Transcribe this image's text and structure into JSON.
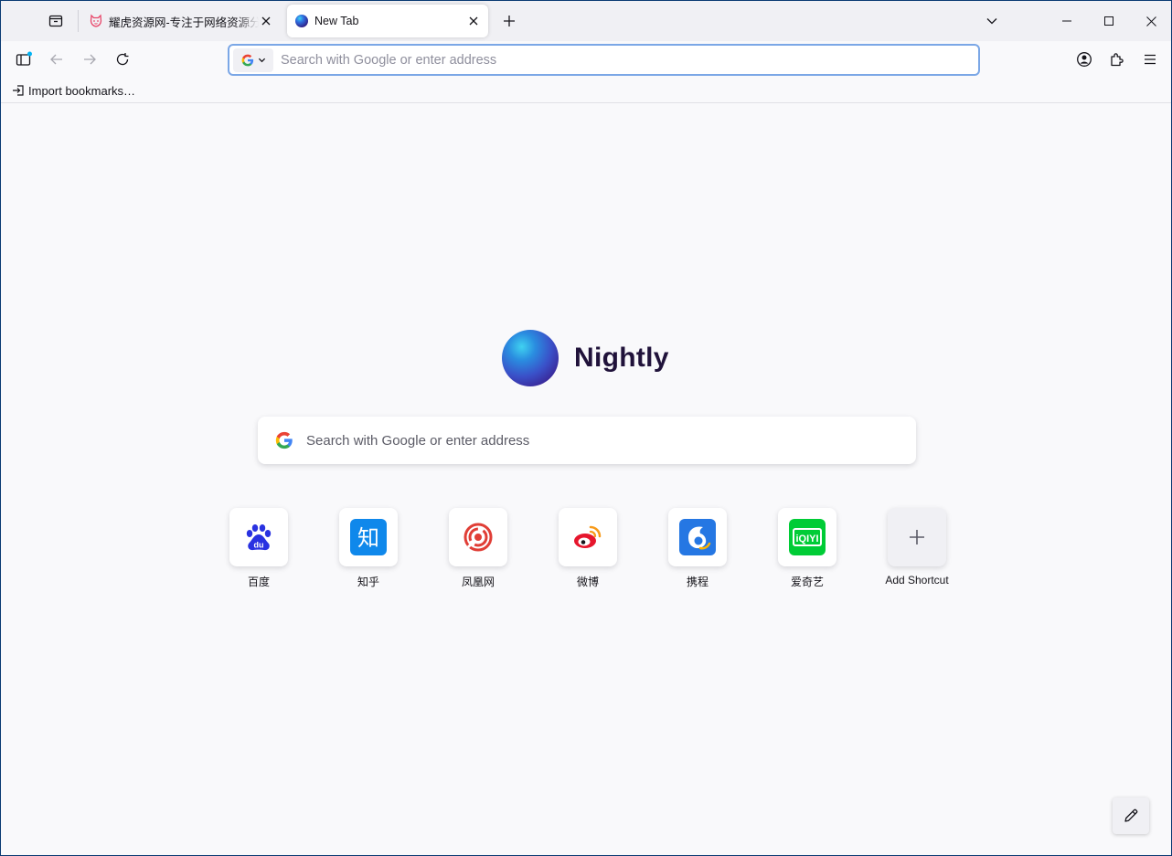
{
  "colors": {
    "accent": "#0061e0",
    "urlbar_focus": "#7ba7e6",
    "window_border": "#0a3a73",
    "tabstrip_bg": "#f0f0f4",
    "content_bg": "#f9f9fb"
  },
  "tabs": [
    {
      "title": "耀虎资源网-专注于网络资源分享",
      "favicon": "tiger-icon",
      "active": false
    },
    {
      "title": "New Tab",
      "favicon": "nightly-icon",
      "active": true
    }
  ],
  "urlbar": {
    "placeholder": "Search with Google or enter address",
    "value": "",
    "engine": "google-icon"
  },
  "bookmarks_toolbar": {
    "import_label": "Import bookmarks…"
  },
  "newtab": {
    "logo_text": "Nightly",
    "search_placeholder": "Search with Google or enter address",
    "shortcuts": [
      {
        "label": "百度",
        "icon": "baidu-icon",
        "color": "#2932e1"
      },
      {
        "label": "知乎",
        "icon": "zhihu-icon",
        "color": "#0f88eb"
      },
      {
        "label": "凤凰网",
        "icon": "ifeng-icon",
        "color": "#e03e36"
      },
      {
        "label": "微博",
        "icon": "weibo-icon",
        "color": "#e6162d"
      },
      {
        "label": "携程",
        "icon": "ctrip-icon",
        "color": "#2577e3"
      },
      {
        "label": "爱奇艺",
        "icon": "iqiyi-icon",
        "color": "#00cc36"
      },
      {
        "label": "Add Shortcut",
        "icon": "plus-icon",
        "color": "#5b5b66"
      }
    ]
  }
}
